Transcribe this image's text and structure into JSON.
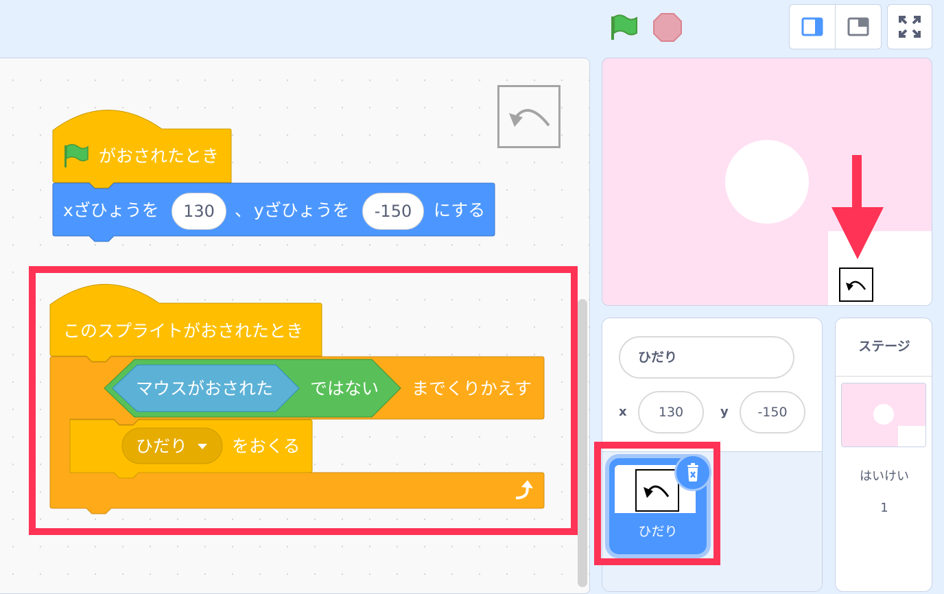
{
  "code": {
    "green_flag_hat": {
      "label": "がおされたとき"
    },
    "goto_block": {
      "label_x": "xざひょうを",
      "x_value": "130",
      "separator": "、",
      "label_y": "yざひょうを",
      "y_value": "-150",
      "suffix": "にする"
    },
    "sprite_clicked_hat": {
      "label": "このスプライトがおされたとき"
    },
    "repeat_until": {
      "condition_inner": "マウスがおされた",
      "condition_not": "ではない",
      "label": "までくりかえす"
    },
    "broadcast_block": {
      "message": "ひだり",
      "label": "をおくる"
    }
  },
  "sprite_info": {
    "name": "ひだり",
    "x_label": "x",
    "x_value": "130",
    "y_label": "y",
    "y_value": "-150"
  },
  "sprite_list": [
    {
      "name": "ひだり",
      "selected": true
    }
  ],
  "stage_panel": {
    "title": "ステージ",
    "backdrops_label": "はいけい",
    "backdrops_count": "1"
  },
  "colors": {
    "highlight": "#ff3355",
    "events": "#ffbf00",
    "motion": "#4c97ff",
    "control": "#ffab19",
    "operators": "#59c059",
    "sensing": "#5cb1d6",
    "stage_bg": "#ffe0f2"
  }
}
